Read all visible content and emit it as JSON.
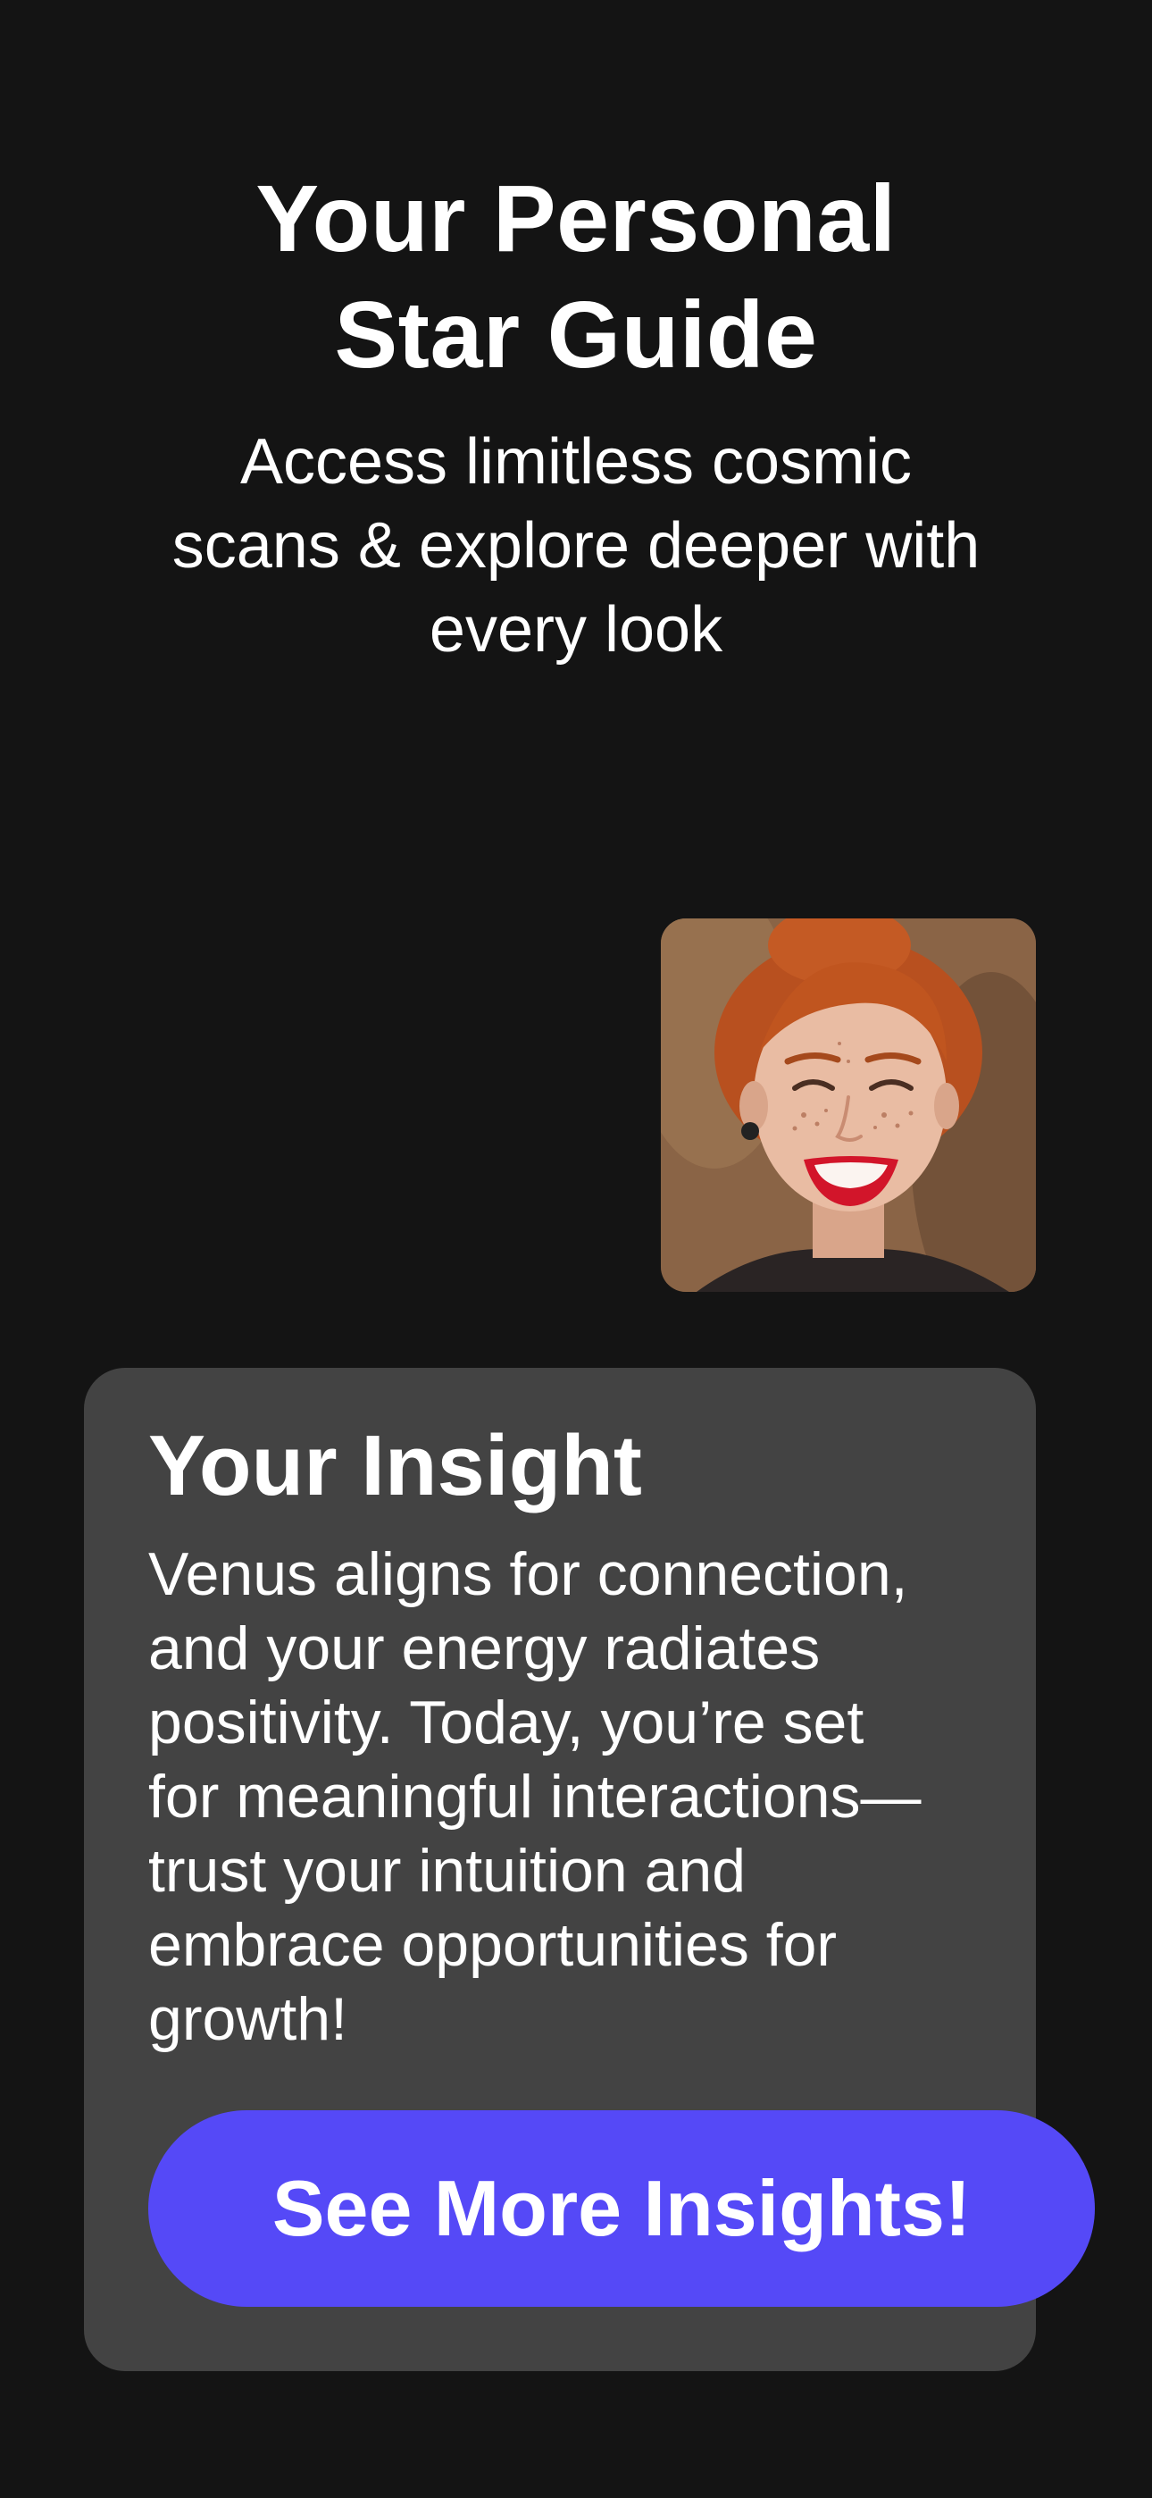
{
  "header": {
    "title_line1": "Your Personal",
    "title_line2": "Star Guide",
    "subtitle_line1": "Access limitless cosmic",
    "subtitle_line2": "scans & explore deeper with",
    "subtitle_line3": "every look"
  },
  "photo": {
    "icon": "user-face-photo"
  },
  "insight": {
    "title": "Your Insight",
    "body_line1": "Venus aligns for connection,",
    "body_line2": "and your energy radiates",
    "body_line3": "positivity. Today, you’re set",
    "body_line4": "for meaningful interactions—",
    "body_line5": "trust your intuition and",
    "body_line6": "embrace opportunities for",
    "body_line7": "growth!"
  },
  "cta": {
    "label": "See More Insights!"
  },
  "colors": {
    "background": "#141414",
    "card": "#434343",
    "accent": "#5549f7",
    "text": "#ffffff"
  }
}
